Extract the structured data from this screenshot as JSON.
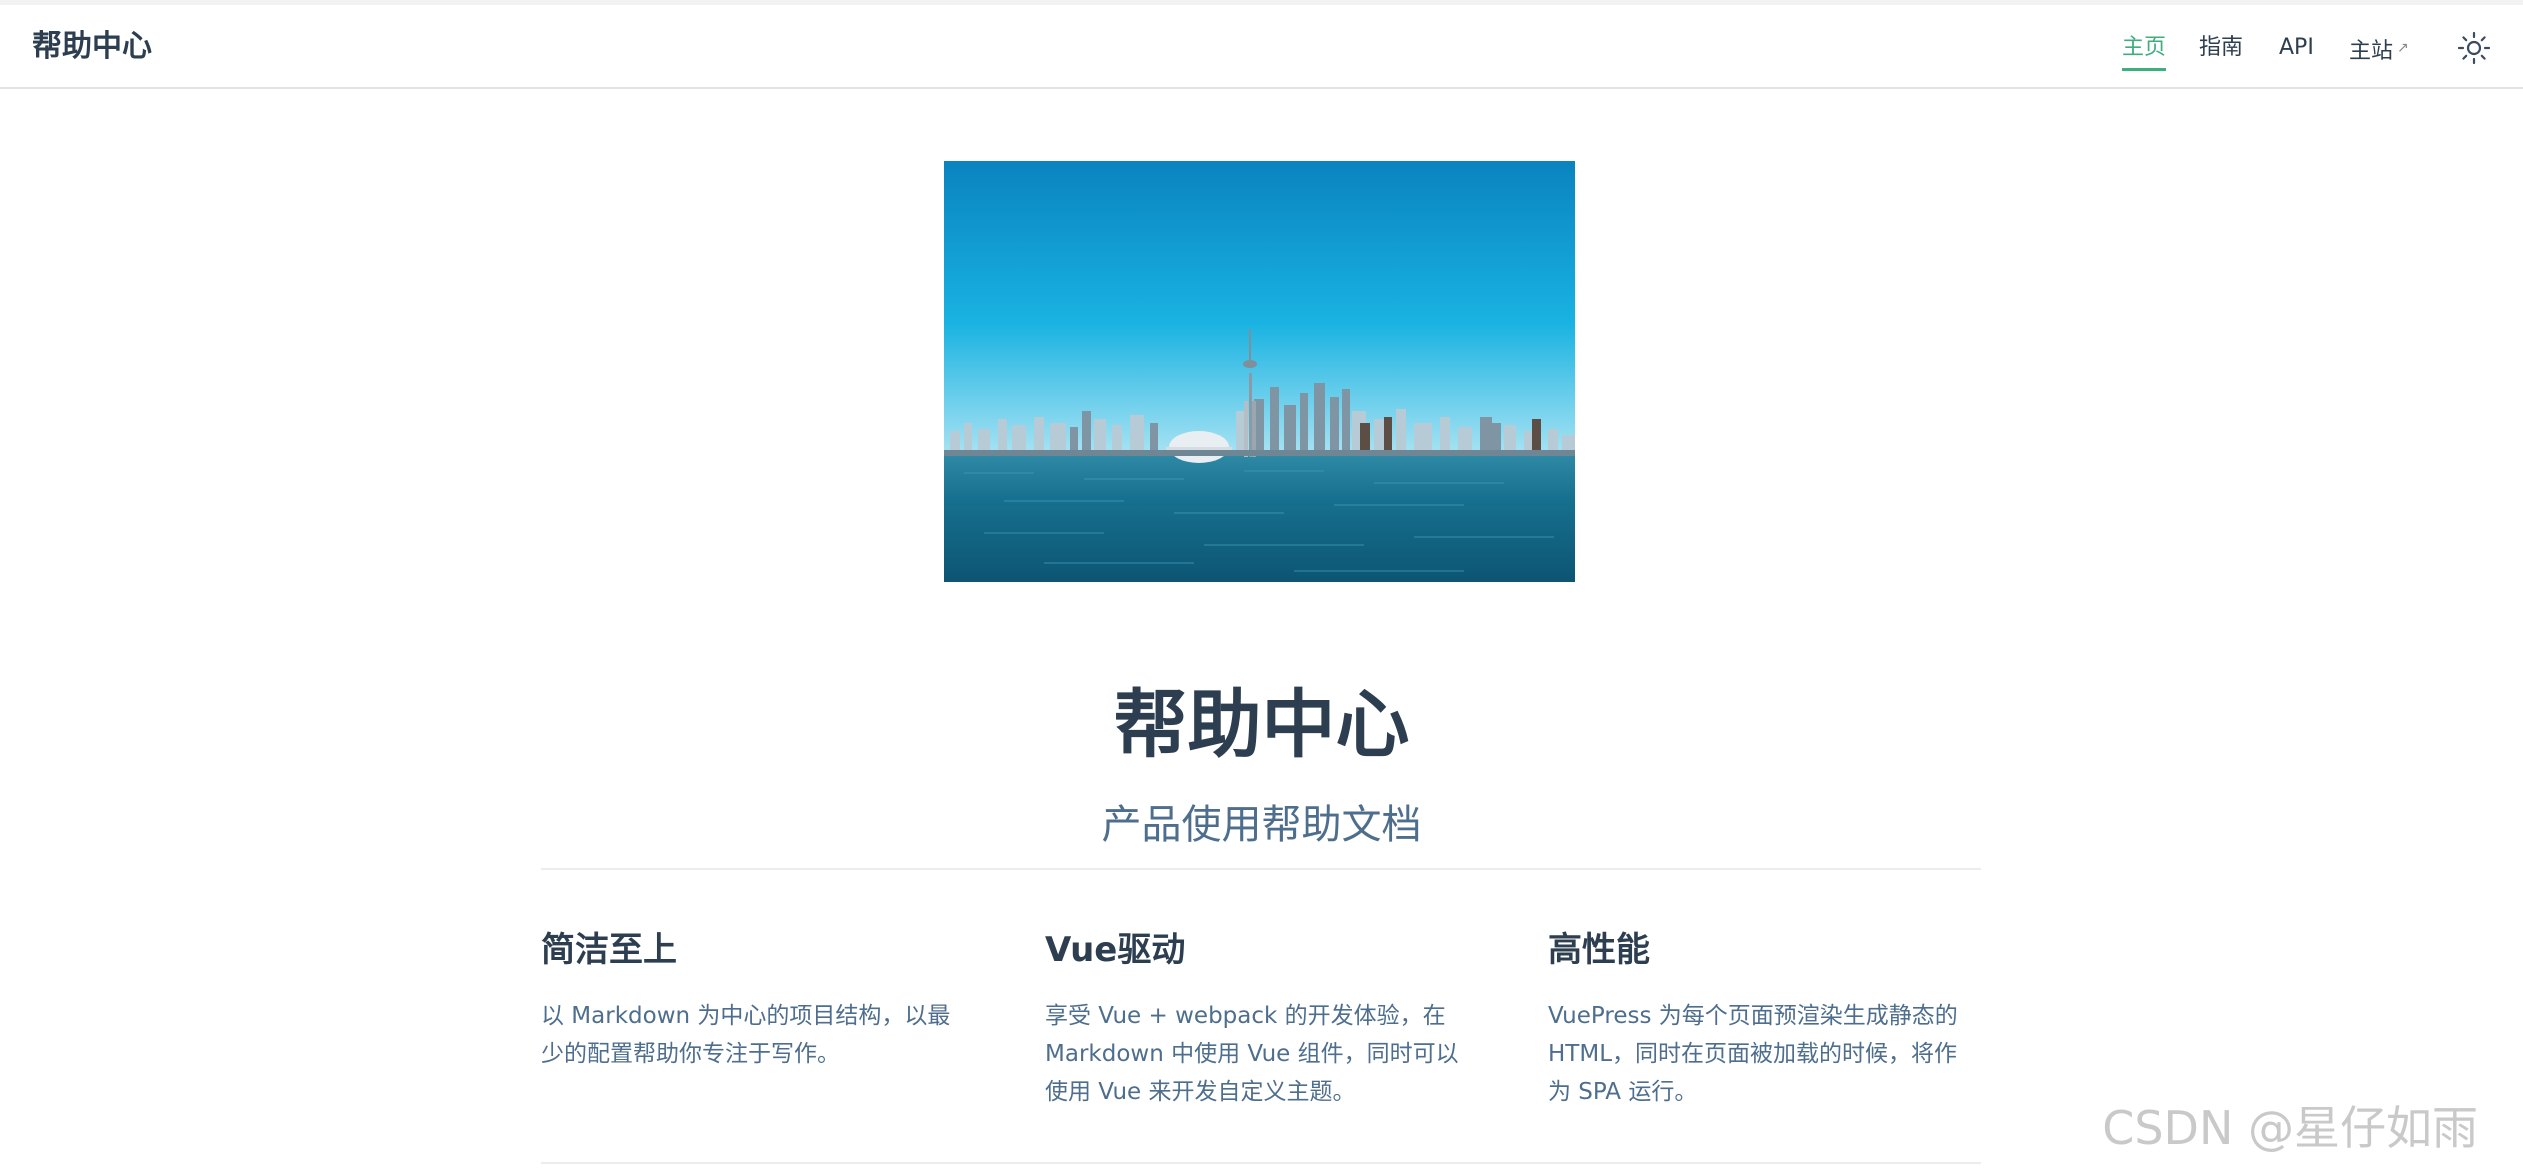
{
  "header": {
    "site_name": "帮助中心",
    "nav": [
      {
        "label": "主页",
        "active": true
      },
      {
        "label": "指南",
        "active": false
      },
      {
        "label": "API",
        "active": false
      },
      {
        "label": "主站",
        "active": false,
        "external": true
      }
    ],
    "external_icon": "external-link-icon",
    "theme_icon": "sun-icon"
  },
  "hero": {
    "image_icon": "city-skyline-image",
    "title": "帮助中心",
    "description": "产品使用帮助文档"
  },
  "features": [
    {
      "title": "简洁至上",
      "details": "以 Markdown 为中心的项目结构，以最少的配置帮助你专注于写作。"
    },
    {
      "title": "Vue驱动",
      "details": "享受 Vue + webpack 的开发体验，在 Markdown 中使用 Vue 组件，同时可以使用 Vue 来开发自定义主题。"
    },
    {
      "title": "高性能",
      "details": "VuePress 为每个页面预渲染生成静态的 HTML，同时在页面被加载的时候，将作为 SPA 运行。"
    }
  ],
  "watermark": "CSDN @星仔如雨",
  "colors": {
    "accent": "#3eaf7c",
    "text": "#2c3e50",
    "muted_text": "#4e6e8e",
    "border": "#eaecef"
  }
}
